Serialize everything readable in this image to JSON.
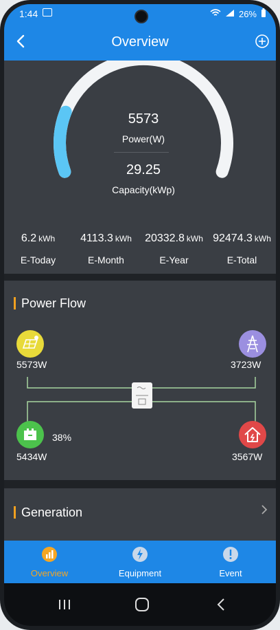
{
  "status_bar": {
    "time": "1:44",
    "battery": "26%"
  },
  "header": {
    "title": "Overview"
  },
  "gauge": {
    "power_value": "5573",
    "power_label": "Power(W)",
    "capacity_value": "29.25",
    "capacity_label": "Capacity(kWp)",
    "fill_fraction": 0.19,
    "track_color": "#f2f4f6",
    "fill_color": "#5bc6f5"
  },
  "stats": [
    {
      "value": "6.2",
      "unit": "kWh",
      "label": "E-Today"
    },
    {
      "value": "4113.3",
      "unit": "kWh",
      "label": "E-Month"
    },
    {
      "value": "20332.8",
      "unit": "kWh",
      "label": "E-Year"
    },
    {
      "value": "92474.3",
      "unit": "kWh",
      "label": "E-Total"
    }
  ],
  "power_flow": {
    "title": "Power Flow",
    "solar": {
      "value": "5573W",
      "icon": "solar-panel-icon",
      "color": "#e8da3a"
    },
    "grid": {
      "value": "3723W",
      "icon": "transmission-tower-icon",
      "color": "#9b8fe0"
    },
    "battery": {
      "value": "5434W",
      "percent": "38%",
      "icon": "battery-icon",
      "color": "#4cc24c"
    },
    "home": {
      "value": "3567W",
      "icon": "home-icon",
      "color": "#e04848"
    },
    "line_color": "#a8d5a0"
  },
  "generation": {
    "title": "Generation"
  },
  "tabs": [
    {
      "label": "Overview",
      "icon": "chart-icon",
      "active": true
    },
    {
      "label": "Equipment",
      "icon": "bolt-icon",
      "active": false
    },
    {
      "label": "Event",
      "icon": "alert-icon",
      "active": false
    }
  ],
  "colors": {
    "accent": "#1e87e6",
    "active_tab": "#f5a623",
    "panel": "#3a3e44"
  }
}
